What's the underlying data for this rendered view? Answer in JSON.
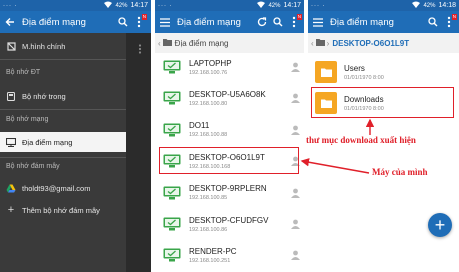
{
  "status": {
    "dots": "··· ·",
    "time_1": "14:17",
    "time_2": "14:17",
    "time_3": "14:18",
    "battery_1": "42%",
    "battery_2": "42%",
    "battery_3": "42%"
  },
  "panel1": {
    "title": "Địa điểm mạng",
    "badge": "N",
    "drawer": {
      "home": "M.hình chính",
      "section_device": "Bộ nhớ ĐT",
      "internal": "Bộ nhớ trong",
      "section_network": "Bộ nhớ mạng",
      "network_places": "Địa điểm mạng",
      "section_cloud": "Bộ nhớ đám mây",
      "account": "tholdt93@gmail.com",
      "add_cloud": "Thêm bộ nhớ đám mây"
    }
  },
  "panel2": {
    "title": "Địa điểm mạng",
    "badge": "N",
    "breadcrumb": "Địa điểm mạng",
    "rows": [
      {
        "name": "LAPTOPHP",
        "ip": "192.168.100.76"
      },
      {
        "name": "DESKTOP-U5A6O8K",
        "ip": "192.168.100.80"
      },
      {
        "name": "DO11",
        "ip": "192.168.100.88"
      },
      {
        "name": "DESKTOP-O6O1L9T",
        "ip": "192.168.100.168"
      },
      {
        "name": "DESKTOP-9RPLERN",
        "ip": "192.168.100.85"
      },
      {
        "name": "DESKTOP-CFUDFGV",
        "ip": "192.168.100.86"
      },
      {
        "name": "RENDER-PC",
        "ip": "192.168.100.251"
      }
    ]
  },
  "panel3": {
    "title": "Địa điểm mạng",
    "badge": "N",
    "breadcrumb": "DESKTOP-O6O1L9T",
    "folders": [
      {
        "name": "Users",
        "date": "01/01/1970 8:00"
      },
      {
        "name": "Downloads",
        "date": "01/01/1970 8:00"
      }
    ],
    "fab_label": "+"
  },
  "annotations": {
    "download_folder": "thư mục download xuất hiện",
    "my_machine": "Máy của mình"
  },
  "colors": {
    "appbar": "#1f6db7",
    "statusbar": "#1e63a9",
    "accent_red": "#e0202a",
    "pc_green": "#3aa54a",
    "folder": "#f5a623"
  }
}
